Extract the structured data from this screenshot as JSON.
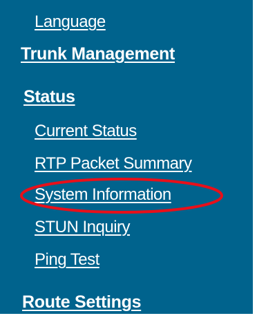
{
  "nav": {
    "items": [
      {
        "label": "Language"
      },
      {
        "label": "Trunk Management"
      },
      {
        "label": "Status"
      },
      {
        "label": "Current Status"
      },
      {
        "label": "RTP Packet Summary"
      },
      {
        "label": "System Information"
      },
      {
        "label": "STUN Inquiry"
      },
      {
        "label": "Ping Test"
      },
      {
        "label": "Route Settings"
      }
    ]
  },
  "colors": {
    "background": "#00638d",
    "text": "#ffffff",
    "highlight": "#e8101a"
  }
}
